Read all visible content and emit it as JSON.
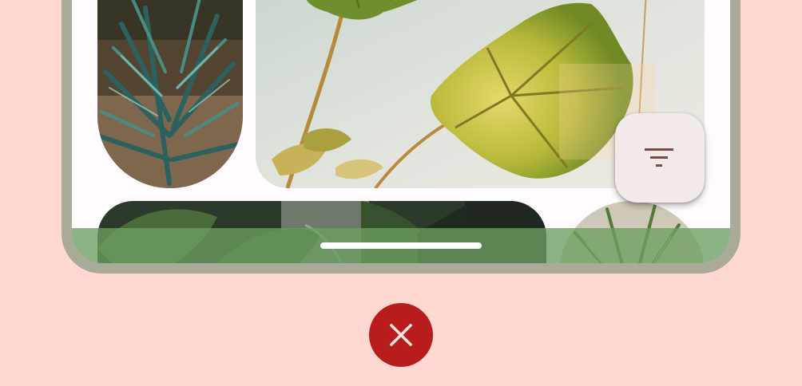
{
  "gallery": {
    "tiles": [
      {
        "icon": "palm-plant-photo"
      },
      {
        "icon": "philodendron-leaf-photo"
      },
      {
        "icon": "dark-leaves-photo"
      },
      {
        "icon": "spider-plant-photo"
      }
    ]
  },
  "fab": {
    "icon": "filter-list-icon"
  },
  "close_button": {
    "icon": "close-icon"
  },
  "colors": {
    "background": "#ffd8d2",
    "phone_frame": "#a7ab98",
    "screen": "#fffbfe",
    "nav_bar": "#6b9f60",
    "fab_surface": "#f2e9e9",
    "fab_icon": "#7a4a44",
    "close_button": "#b81c1c"
  }
}
